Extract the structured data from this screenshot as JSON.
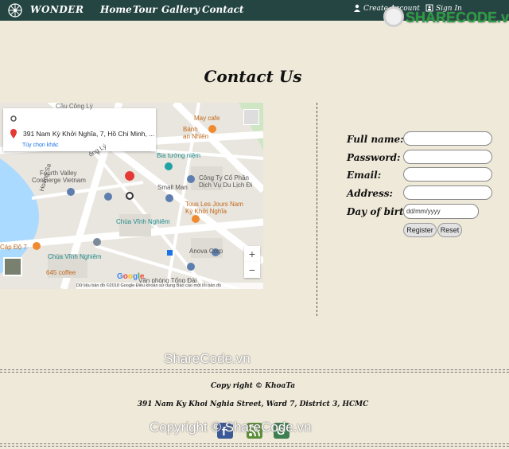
{
  "nav": {
    "brand": "WONDER",
    "links": [
      "Home",
      "Tour",
      "Gallery",
      "Contact"
    ],
    "create_account": "Create Account",
    "sign_in": "Sign In"
  },
  "watermark": {
    "top_main": "SHARECODE",
    "top_suffix": ".vn",
    "mid": "ShareCode.vn",
    "bottom": "Copyright © ShareCode.vn"
  },
  "page": {
    "title": "Contact Us"
  },
  "map": {
    "search_address": "391 Nam Kỳ Khởi Nghĩa, 7, Hồ Chí Minh, ...",
    "directions_link": "Tùy chọn khác",
    "places": [
      "Cầu Công Lý",
      "May cafe",
      "Bánh",
      "an Nhiên",
      "Bia tướng niệm",
      "Công Ty Cổ Phần",
      "Dịch Vụ Du Lịch Đi",
      "Fourth Valley",
      "Concierge Vietnam",
      "Small Man",
      "Tous Les Jours Nam",
      "Kỳ Khởi Nghĩa",
      "Chùa Vĩnh Nghiêm",
      "Hoàng Sa",
      "Cáp Độ 7",
      "Anova Corp",
      "Chùa Vĩnh Nghiêm",
      "645 coffee",
      "Văn phòng Tổng Đài",
      "ông Lý"
    ],
    "zoom_in": "+",
    "zoom_out": "−",
    "google": "Google",
    "footer": "Dữ liệu bản đồ ©2018 Google   Điều khoản sử dụng   Báo cáo một lỗi bản đồ"
  },
  "form": {
    "full_name_label": "Full name:",
    "password_label": "Password:",
    "email_label": "Email:",
    "address_label": "Address:",
    "dob_label": "Day of birth:",
    "dob_placeholder": "dd/mm/yyyy",
    "register": "Register",
    "reset": "Reset"
  },
  "footer": {
    "copyright": "Copy right © KhoaTa",
    "address": "391 Nam Ky Khoi Nghia Street, Ward 7, District 3, HCMC"
  },
  "colors": {
    "nav_bg": "#244542",
    "page_bg": "#efe9d9",
    "accent_green": "#2a9f43"
  }
}
